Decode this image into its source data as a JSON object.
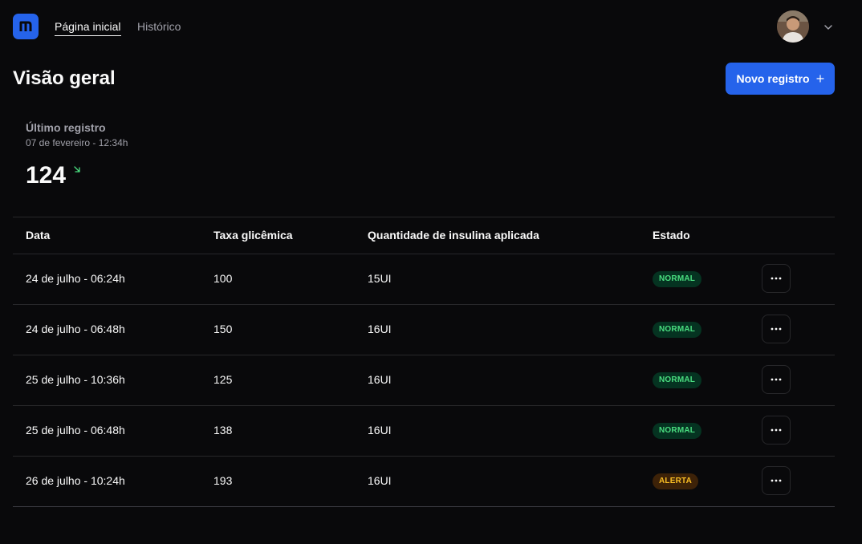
{
  "header": {
    "nav": [
      {
        "label": "Página inicial",
        "active": true
      },
      {
        "label": "Histórico",
        "active": false
      }
    ]
  },
  "page": {
    "title": "Visão geral",
    "new_button_label": "Novo registro",
    "new_button_icon": "plus-icon"
  },
  "summary": {
    "label": "Último registro",
    "date": "07 de fevereiro - 12:34h",
    "value": "124",
    "trend_icon": "arrow-down-right-icon",
    "trend_color": "#4ade80"
  },
  "table": {
    "columns": [
      "Data",
      "Taxa glicêmica",
      "Quantidade de insulina aplicada",
      "Estado"
    ],
    "rows": [
      {
        "date": "24 de julho - 06:24h",
        "glucose": "100",
        "insulin": "15UI",
        "status": "NORMAL",
        "status_type": "normal"
      },
      {
        "date": "24 de julho - 06:48h",
        "glucose": "150",
        "insulin": "16UI",
        "status": "NORMAL",
        "status_type": "normal"
      },
      {
        "date": "25 de julho - 10:36h",
        "glucose": "125",
        "insulin": "16UI",
        "status": "NORMAL",
        "status_type": "normal"
      },
      {
        "date": "25 de julho - 06:48h",
        "glucose": "138",
        "insulin": "16UI",
        "status": "NORMAL",
        "status_type": "normal"
      },
      {
        "date": "26 de julho - 10:24h",
        "glucose": "193",
        "insulin": "16UI",
        "status": "ALERTA",
        "status_type": "alert"
      }
    ]
  },
  "colors": {
    "background": "#09090b",
    "accent": "#2563eb",
    "normal_badge_bg": "#053321",
    "normal_badge_text": "#4ade80",
    "alert_badge_bg": "#3d2208",
    "alert_badge_text": "#fbbf24"
  }
}
